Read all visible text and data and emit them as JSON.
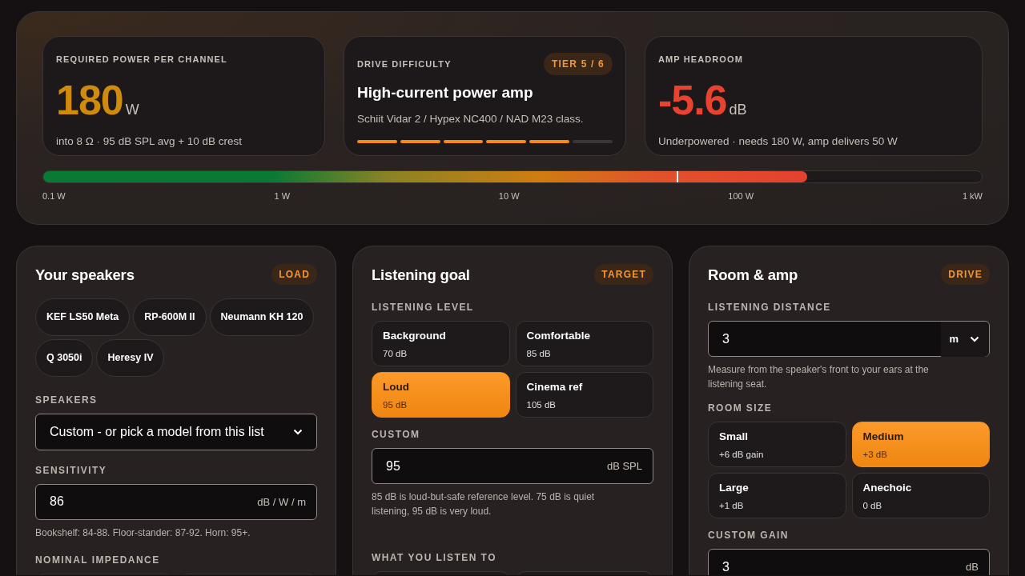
{
  "summary": {
    "stats": [
      {
        "kind": "power",
        "label": "REQUIRED POWER PER CHANNEL",
        "value": "180",
        "unit": "W",
        "color": "#d08a0c",
        "note": "into 8 Ω · 95 dB SPL avg + 10 dB crest"
      },
      {
        "kind": "tier",
        "label": "DRIVE DIFFICULTY",
        "badge": "TIER 5 / 6",
        "title": "High-current power amp",
        "note": "Schiit Vidar 2 / Hypex NC400 / NAD M23 class.",
        "segments": [
          {
            "on": true
          },
          {
            "on": true
          },
          {
            "on": true
          },
          {
            "on": true
          },
          {
            "on": true
          },
          {
            "on": false
          }
        ]
      },
      {
        "kind": "headroom",
        "label": "AMP HEADROOM",
        "value": "-5.6",
        "unit": "dB",
        "color": "#e8432f",
        "note": "Underpowered · needs 180 W, amp delivers 50 W"
      }
    ],
    "meter": {
      "level": 0.814,
      "marker": {
        "level": 0.675
      },
      "ticks": [
        "0.1 W",
        "1 W",
        "10 W",
        "100 W",
        "1 kW"
      ]
    }
  },
  "panels": [
    {
      "title": "Your speakers",
      "tag": "LOAD",
      "sections": [
        {
          "kind": "chips",
          "chips": [
            "KEF LS50 Meta",
            "RP-600M II",
            "Neumann KH 120",
            "Q 3050i",
            "Heresy IV"
          ]
        },
        {
          "kind": "select",
          "label": "SPEAKERS",
          "value": "Custom - or pick a model from this list"
        },
        {
          "kind": "input",
          "label": "SENSITIVITY",
          "value": "86",
          "unit": "dB / W / m",
          "hint": "Bookshelf: 84-88. Floor-stander: 87-92. Horn: 95+."
        },
        {
          "kind": "options",
          "label": "NOMINAL IMPEDANCE",
          "options": [
            {
              "selected": false
            },
            {
              "selected": false
            }
          ]
        }
      ]
    },
    {
      "title": "Listening goal",
      "tag": "TARGET",
      "sections": [
        {
          "kind": "options",
          "label": "LISTENING LEVEL",
          "options": [
            {
              "name": "Background",
              "sub": "70 dB",
              "selected": false
            },
            {
              "name": "Comfortable",
              "sub": "85 dB",
              "selected": false
            },
            {
              "name": "Loud",
              "sub": "95 dB",
              "selected": true
            },
            {
              "name": "Cinema ref",
              "sub": "105 dB",
              "selected": false
            }
          ]
        },
        {
          "kind": "input",
          "label": "CUSTOM",
          "value": "95",
          "unit": "dB SPL",
          "hint": "85 dB is loud-but-safe reference level. 75 dB is quiet listening, 95 dB is very loud."
        },
        {
          "kind": "options",
          "label": "WHAT YOU LISTEN TO",
          "options": [
            {
              "selected": false
            },
            {
              "selected": false
            }
          ]
        }
      ]
    },
    {
      "title": "Room & amp",
      "tag": "DRIVE",
      "sections": [
        {
          "kind": "input",
          "label": "LISTENING DISTANCE",
          "value": "3",
          "unit_select": "m",
          "hint": "Measure from the speaker's front to your ears at the listening seat."
        },
        {
          "kind": "options",
          "label": "ROOM SIZE",
          "options": [
            {
              "name": "Small",
              "sub": "+6 dB gain",
              "selected": false
            },
            {
              "name": "Medium",
              "sub": "+3 dB",
              "selected": true
            },
            {
              "name": "Large",
              "sub": "+1 dB",
              "selected": false
            },
            {
              "name": "Anechoic",
              "sub": "0 dB",
              "selected": false
            }
          ]
        },
        {
          "kind": "input",
          "label": "CUSTOM GAIN",
          "value": "3",
          "unit": "dB"
        }
      ]
    }
  ]
}
